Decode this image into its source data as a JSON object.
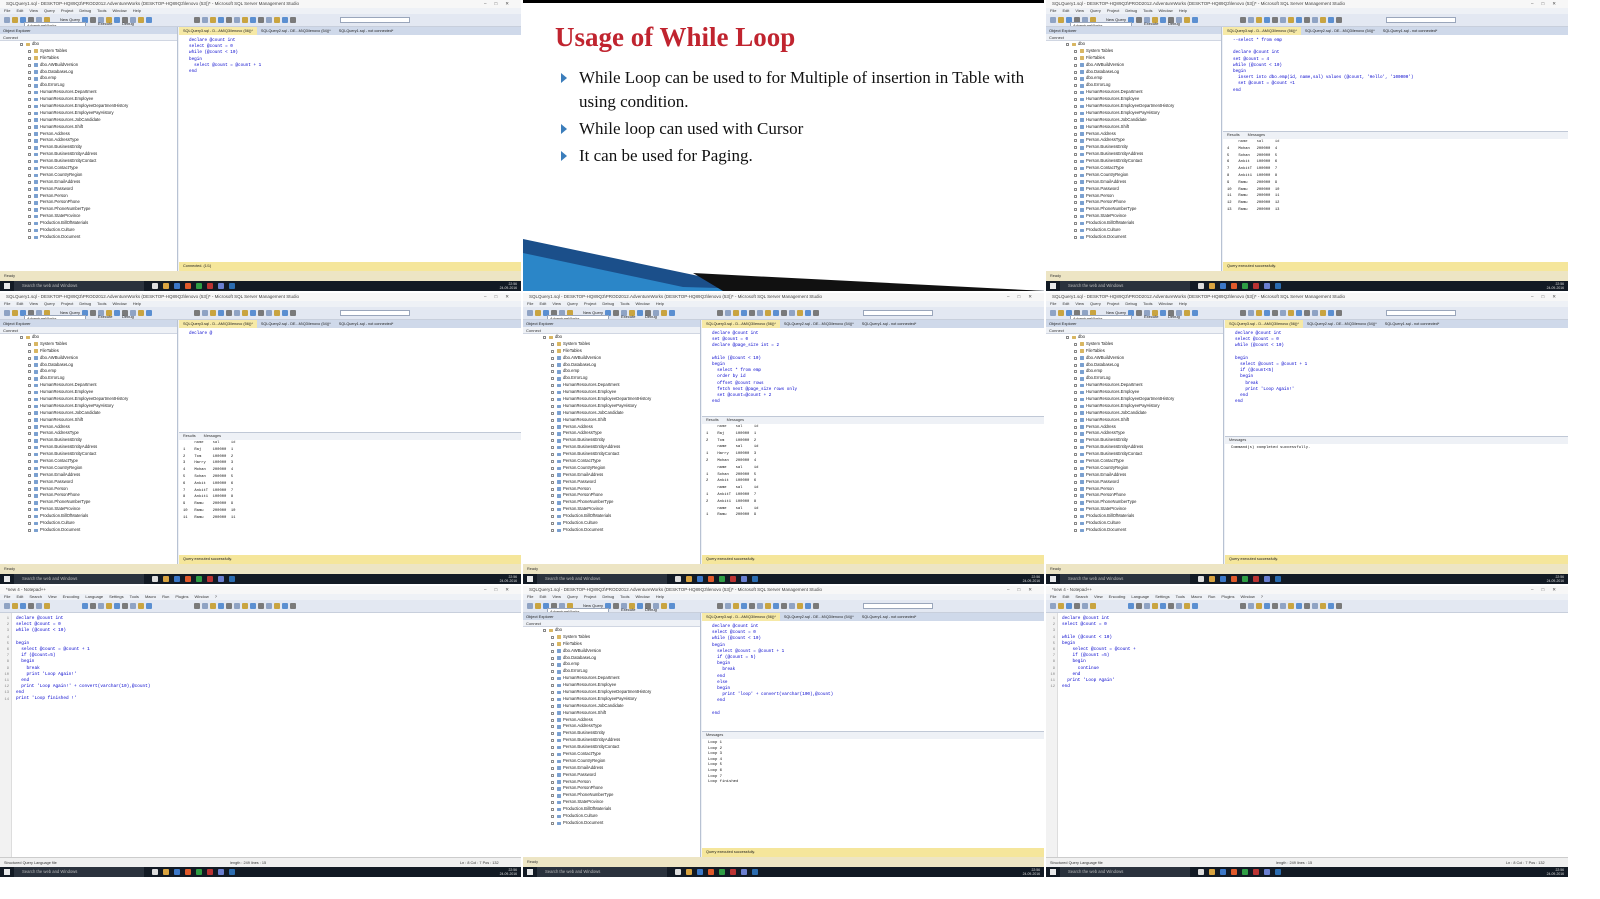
{
  "slide": {
    "title": "Usage of While Loop",
    "bullets": [
      "While Loop can be used to for Multiple of insertion in Table with using condition.",
      "While loop can used with Cursor",
      "It can be used for Paging."
    ]
  },
  "common": {
    "ssms_title": "SQLQuery1.sql - DESKTOP-HQ89Q3\\PROD2012.AdventureWorks (DESKTOP-HQ89Q3\\lenovo (53))* - Microsoft SQL Server Management Studio",
    "notepad_title": "*new 4 - Notepad++",
    "menu_ssms": [
      "File",
      "Edit",
      "View",
      "Query",
      "Project",
      "Debug",
      "Tools",
      "Window",
      "Help"
    ],
    "menu_np": [
      "File",
      "Edit",
      "Search",
      "View",
      "Encoding",
      "Language",
      "Settings",
      "Tools",
      "Macro",
      "Run",
      "Plugins",
      "Window",
      "?"
    ],
    "toolbar": {
      "new_query": "New Query",
      "execute": "Execute",
      "debug": "Debug",
      "database": "AdventureWorks"
    },
    "oe_header": "Object Explorer",
    "oe_connect": "Connect",
    "tabs": [
      "SQLQuery3.sql - D...AM\\Q3\\lenovo (56))*",
      "SQLQuery2.sql - DE...M\\Q3\\lenovo (54))*",
      "SQLQuery1.sql - not connected*"
    ],
    "search_placeholder": "Search the web and Windows",
    "clock_time": "22:56",
    "clock_date": "24-09-2016",
    "result_tab": "Results",
    "messages_tab": "Messages",
    "zoom": "100 %",
    "ready": "Ready",
    "query_ok": "Query executed successfully.",
    "connected": "Connected. (1/1)",
    "server_info": "DESKTOP-HQ89Q3\\PROD2012 (1...  DESKTOP-HQ89Q3\\lenovo...  AdventureWorks  00:00:00  0 rows",
    "np_status_left": "Structured Query Language file",
    "np_status_mid": "length : 249    lines : 15",
    "np_status_right": "Ln : 8    Col : 7    Pos : 132",
    "np_status_enc": "Windows (CR LF)   UTF-8   INS"
  },
  "object_explorer_items": [
    "dbo",
    "System Tables",
    "FileTables",
    "dbo.AWBuildVersion",
    "dbo.DatabaseLog",
    "dbo.emp",
    "dbo.ErrorLog",
    "HumanResources.Department",
    "HumanResources.Employee",
    "HumanResources.EmployeeDepartmentHistory",
    "HumanResources.EmployeePayHistory",
    "HumanResources.JobCandidate",
    "HumanResources.Shift",
    "Person.Address",
    "Person.AddressType",
    "Person.BusinessEntity",
    "Person.BusinessEntityAddress",
    "Person.BusinessEntityContact",
    "Person.ContactType",
    "Person.CountryRegion",
    "Person.EmailAddress",
    "Person.Password",
    "Person.Person",
    "Person.PersonPhone",
    "Person.PhoneNumberType",
    "Person.StateProvince",
    "Production.BillOfMaterials",
    "Production.Culture",
    "Production.Document"
  ],
  "panels": {
    "p1_code": [
      "declare @count int",
      "select @count = 0",
      "while (@count < 10)",
      "begin",
      "  select @count = @count + 1",
      "end"
    ],
    "p3_code": [
      "--select * from emp",
      "",
      "declare @count int",
      "set @count = 4",
      "while (@count < 10)",
      "begin",
      "  insert into dbo.emp(id, name,sal) values (@count, 'Hello', '100000')",
      "  set @count = @count +1",
      "end"
    ],
    "p3_results": [
      "     name    sal     id",
      "4    Mohan   200000  4",
      "5    Sohan   200000  5",
      "6    Ankit   100000  6",
      "7    AnkitT  100000  7",
      "8    Ankit1  100000  8",
      "9    Ramu    200000  9",
      "10   Ramu    200000  10",
      "11   Ramu    200000  11",
      "12   Ramu    200000  12",
      "13   Ramu    200000  13"
    ],
    "p4_code": [
      "declare @"
    ],
    "p4_results": [
      "     name    sal     id",
      "1    Raj     100000  1",
      "2    Tom     100000  2",
      "3    Harry   100000  3",
      "4    Mohan   200000  4",
      "5    Sohan   200000  5",
      "6    Ankit   100000  6",
      "7    AnkitT  100000  7",
      "8    Ankit1  100000  8",
      "9    Ramu    200000  9",
      "10   Ramu    200000  10",
      "11   Ramu    200000  11"
    ],
    "p5_code": [
      "declare @count int",
      "set @count = 0",
      "declare @page_size int = 2",
      "",
      "while (@count < 10)",
      "begin",
      "  select * from emp",
      "  order by id",
      "  offset @count rows",
      "  fetch next @page_size rows only",
      "  set @count=@count + 2",
      "end"
    ],
    "p5_results": [
      "     name    sal     id",
      "1    Raj     100000  1",
      "2    Tom     100000  2",
      "     name    sal     id",
      "1    Harry   100000  3",
      "2    Mohan   200000  4",
      "     name    sal     id",
      "1    Sohan   200000  5",
      "2    Ankit   100000  6",
      "     name    sal     id",
      "1    AnkitT  100000  7",
      "2    Ankit1  100000  8",
      "     name    sal     id",
      "1    Ramu    200000  9"
    ],
    "p6_code": [
      "declare @count int",
      "select @count = 0",
      "while (@count < 10)",
      "",
      "begin",
      "  select @count = @count + 1",
      "  if (@count<5)",
      "  begin",
      "    break",
      "    print 'Loop Again!'",
      "  end",
      "end"
    ],
    "p6_message": "Command(s) completed successfully.",
    "p7_code": [
      "declare @count int",
      "select @count = 0",
      "while (@count < 10)",
      "",
      "begin",
      "  select @count = @count + 1",
      "  if (@count=5)",
      "  begin",
      "    break",
      "    print 'Loop Again!'",
      "  end",
      "  print 'Loop Again!' + convert(varchar(10),@count)",
      "end",
      "print 'Loop finished !'"
    ],
    "p8_code": [
      "declare @count int",
      "select @count = 0",
      "while (@count < 10)",
      "begin",
      "  select @count = @count + 1",
      "  if (@count = 5)",
      "  begin",
      "    break",
      "  end",
      "  else",
      "  begin",
      "    print 'loop' + convert(varchar(100),@count)",
      "  end",
      "",
      "end"
    ],
    "p8_messages": [
      "Loop 1",
      "Loop 2",
      "Loop 3",
      "Loop 4",
      "Loop 5",
      "Loop 6",
      "Loop 7",
      "Loop finished"
    ],
    "p9_code": [
      "declare @count int",
      "select @count = 0",
      "",
      "while (@count < 10)",
      "begin",
      "    select @count = @count +",
      "    if (@count =5)",
      "    begin",
      "      continue",
      "    end",
      "  print 'Loop Again'",
      "end"
    ]
  },
  "colors": {
    "slide_title": "#c0242f",
    "bullet": "#3b7dbb",
    "code": "#0000cc",
    "taskbar": "#121a24"
  }
}
